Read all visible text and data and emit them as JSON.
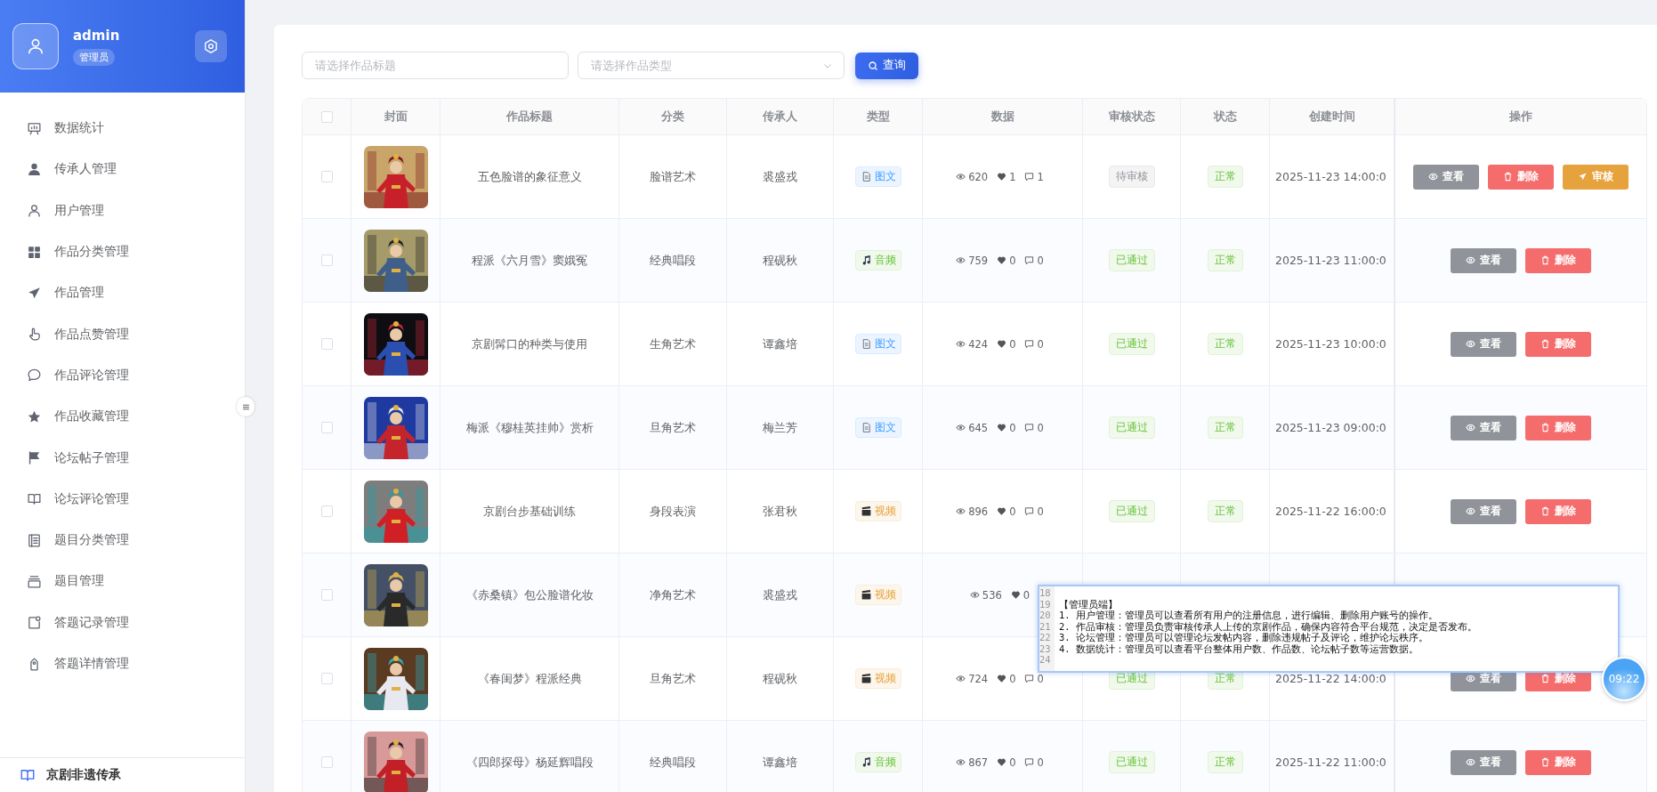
{
  "sidebar": {
    "user": {
      "name": "admin",
      "role": "管理员"
    },
    "items": [
      {
        "label": "数据统计"
      },
      {
        "label": "传承人管理"
      },
      {
        "label": "用户管理"
      },
      {
        "label": "作品分类管理"
      },
      {
        "label": "作品管理"
      },
      {
        "label": "作品点赞管理"
      },
      {
        "label": "作品评论管理"
      },
      {
        "label": "作品收藏管理"
      },
      {
        "label": "论坛帖子管理"
      },
      {
        "label": "论坛评论管理"
      },
      {
        "label": "题目分类管理"
      },
      {
        "label": "题目管理"
      },
      {
        "label": "答题记录管理"
      },
      {
        "label": "答题详情管理"
      }
    ],
    "footer": {
      "label": "京剧非遗传承"
    }
  },
  "filters": {
    "title_placeholder": "请选择作品标题",
    "type_placeholder": "请选择作品类型",
    "search_button": "查询"
  },
  "table": {
    "select_all": {
      "checked": false
    },
    "columns": [
      "封面",
      "作品标题",
      "分类",
      "传承人",
      "类型",
      "数据",
      "审核状态",
      "状态",
      "创建时间",
      "操作"
    ],
    "rows": [
      {
        "checked": false,
        "cover": {
          "kind": "picture"
        },
        "title": "五色脸谱的象征意义",
        "category": "脸谱艺术",
        "inheritor": "裘盛戎",
        "type": {
          "kind": "text",
          "label": "图文"
        },
        "views": "620",
        "likes": "1",
        "comments": "1",
        "audit": {
          "kind": "pending",
          "label": "待审核"
        },
        "status": "正常",
        "created": "2025-11-23 14:00:0",
        "actions": [
          {
            "kind": "view",
            "label": "查看"
          },
          {
            "kind": "delete",
            "label": "删除"
          },
          {
            "kind": "review",
            "label": "审核"
          }
        ]
      },
      {
        "checked": false,
        "cover": {
          "kind": "picture"
        },
        "title": "程派《六月雪》窦娥冤",
        "category": "经典唱段",
        "inheritor": "程砚秋",
        "type": {
          "kind": "audio",
          "label": "音频"
        },
        "views": "759",
        "likes": "0",
        "comments": "0",
        "audit": {
          "kind": "approved",
          "label": "已通过"
        },
        "status": "正常",
        "created": "2025-11-23 11:00:0",
        "actions": [
          {
            "kind": "view",
            "label": "查看"
          },
          {
            "kind": "delete",
            "label": "删除"
          }
        ]
      },
      {
        "checked": false,
        "cover": {
          "kind": "picture"
        },
        "title": "京剧髯口的种类与使用",
        "category": "生角艺术",
        "inheritor": "谭鑫培",
        "type": {
          "kind": "text",
          "label": "图文"
        },
        "views": "424",
        "likes": "0",
        "comments": "0",
        "audit": {
          "kind": "approved",
          "label": "已通过"
        },
        "status": "正常",
        "created": "2025-11-23 10:00:0",
        "actions": [
          {
            "kind": "view",
            "label": "查看"
          },
          {
            "kind": "delete",
            "label": "删除"
          }
        ]
      },
      {
        "checked": false,
        "cover": {
          "kind": "picture"
        },
        "title": "梅派《穆桂英挂帅》赏析",
        "category": "旦角艺术",
        "inheritor": "梅兰芳",
        "type": {
          "kind": "text",
          "label": "图文"
        },
        "views": "645",
        "likes": "0",
        "comments": "0",
        "audit": {
          "kind": "approved",
          "label": "已通过"
        },
        "status": "正常",
        "created": "2025-11-23 09:00:0",
        "actions": [
          {
            "kind": "view",
            "label": "查看"
          },
          {
            "kind": "delete",
            "label": "删除"
          }
        ]
      },
      {
        "checked": false,
        "cover": {
          "kind": "picture"
        },
        "title": "京剧台步基础训练",
        "category": "身段表演",
        "inheritor": "张君秋",
        "type": {
          "kind": "video",
          "label": "视频"
        },
        "views": "896",
        "likes": "0",
        "comments": "0",
        "audit": {
          "kind": "approved",
          "label": "已通过"
        },
        "status": "正常",
        "created": "2025-11-22 16:00:0",
        "actions": [
          {
            "kind": "view",
            "label": "查看"
          },
          {
            "kind": "delete",
            "label": "删除"
          }
        ]
      },
      {
        "checked": false,
        "cover": {
          "kind": "picture"
        },
        "title": "《赤桑镇》包公脸谱化妆",
        "category": "净角艺术",
        "inheritor": "裘盛戎",
        "type": {
          "kind": "video",
          "label": "视频"
        },
        "views": "536",
        "likes": "0"
      },
      {
        "checked": false,
        "cover": {
          "kind": "picture"
        },
        "title": "《春闺梦》程派经典",
        "category": "旦角艺术",
        "inheritor": "程砚秋",
        "type": {
          "kind": "video",
          "label": "视频"
        },
        "views": "724",
        "likes": "0",
        "comments": "0",
        "audit": {
          "kind": "approved",
          "label": "已通过"
        },
        "status": "正常",
        "created": "2025-11-22 14:00:0",
        "actions": [
          {
            "kind": "view",
            "label": "查看"
          },
          {
            "kind": "delete",
            "label": "删除"
          }
        ]
      },
      {
        "checked": false,
        "cover": {
          "kind": "picture"
        },
        "title": "《四郎探母》杨延辉唱段",
        "category": "经典唱段",
        "inheritor": "谭鑫培",
        "type": {
          "kind": "audio",
          "label": "音频"
        },
        "views": "867",
        "likes": "0",
        "comments": "0",
        "audit": {
          "kind": "approved",
          "label": "已通过"
        },
        "status": "正常",
        "created": "2025-11-22 11:00:0",
        "actions": [
          {
            "kind": "view",
            "label": "查看"
          },
          {
            "kind": "delete",
            "label": "删除"
          }
        ]
      }
    ]
  },
  "editor_popup": {
    "lines": [
      {
        "number": "18"
      },
      {
        "number": "19",
        "text": "【管理员端】"
      },
      {
        "number": "20",
        "text": "1. 用户管理：管理员可以查看所有用户的注册信息，进行编辑、删除用户账号的操作。"
      },
      {
        "number": "21",
        "text": "2. 作品审核：管理员负责审核传承人上传的京剧作品，确保内容符合平台规范，决定是否发布。"
      },
      {
        "number": "22",
        "text": "3. 论坛管理：管理员可以管理论坛发帖内容，删除违规帖子及评论，维护论坛秩序。"
      },
      {
        "number": "23",
        "text": "4. 数据统计：管理员可以查看平台整体用户数、作品数、论坛帖子数等运营数据。"
      },
      {
        "number": "24"
      }
    ]
  },
  "clock_bubble": {
    "time": "09:22"
  }
}
